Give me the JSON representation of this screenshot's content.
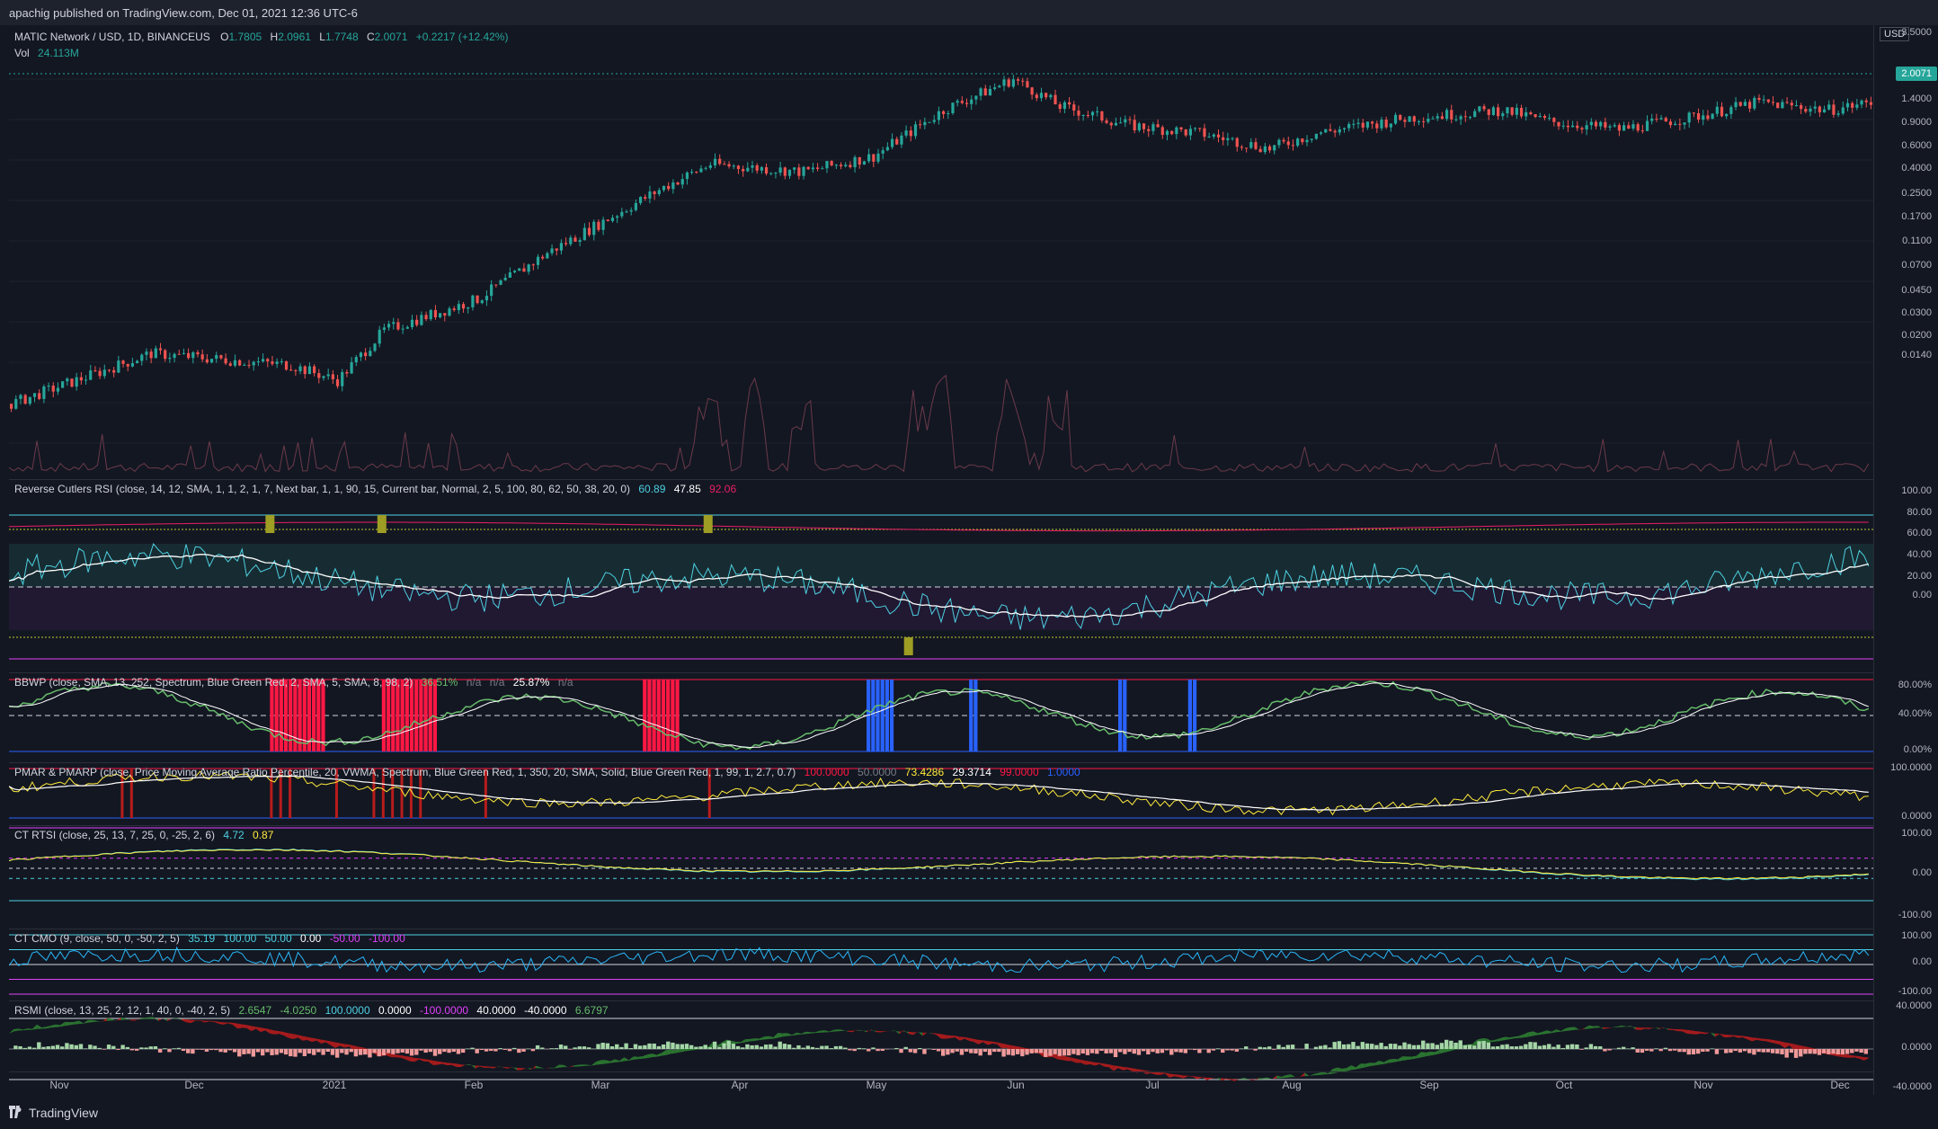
{
  "publisher": "apachig published on TradingView.com, Dec 01, 2021 12:36 UTC-6",
  "symbol": {
    "name": "MATIC Network / USD, 1D, BINANCEUS",
    "o_label": "O",
    "o": "1.7805",
    "h_label": "H",
    "h": "2.0961",
    "l_label": "L",
    "l": "1.7748",
    "c_label": "C",
    "c": "2.0071",
    "change": "+0.2217 (+12.42%)",
    "vol_label": "Vol",
    "vol": "24.113M"
  },
  "price_axis": {
    "currency": "USD",
    "last_price": "2.0071",
    "ticks": [
      "3.5000",
      "1.4000",
      "0.9000",
      "0.6000",
      "0.4000",
      "0.2500",
      "0.1700",
      "0.1100",
      "0.0700",
      "0.0450",
      "0.0300",
      "0.0200",
      "0.0140"
    ]
  },
  "indicators": [
    {
      "title": "Reverse Cutlers RSI (close, 14, 12, SMA, 1, 1, 2, 1, 7, Next bar, 1, 1, 90, 15, Current bar, Normal, 2, 5, 100, 80, 62, 50, 38, 20, 0)",
      "values": [
        "60.89",
        "47.85",
        "92.06"
      ],
      "value_colors": [
        "#4dd0e1",
        "#ffffff",
        "#e91e63"
      ],
      "axis": [
        "100.00",
        "80.00",
        "60.00",
        "40.00",
        "20.00",
        "0.00"
      ]
    },
    {
      "title": "BBWP (close, SMA, 13, 252, Spectrum, Blue Green Red, 2, SMA, 5, SMA, 8, 98, 2)",
      "values": [
        "36.51%",
        "n/a",
        "n/a",
        "25.87%",
        "n/a"
      ],
      "value_colors": [
        "#66bb6a",
        "#787b86",
        "#787b86",
        "#ffffff",
        "#787b86"
      ],
      "axis": [
        "80.00%",
        "40.00%",
        "0.00%"
      ]
    },
    {
      "title": "PMAR & PMARP (close, Price Moving Average Ratio Percentile, 20, VWMA, Spectrum, Blue Green Red, 1, 350, 20, SMA, Solid, Blue Green Red, 1, 99, 1, 2.7, 0.7)",
      "values": [
        "100.0000",
        "50.0000",
        "73.4286",
        "29.3714",
        "99.0000",
        "1.0000"
      ],
      "value_colors": [
        "#ff1744",
        "#787b86",
        "#ffeb3b",
        "#ffffff",
        "#ff1744",
        "#2962ff"
      ],
      "axis": [
        "100.0000",
        "0.0000"
      ]
    },
    {
      "title": "CT RTSI (close, 25, 13, 7, 25, 0, -25, 2, 6)",
      "values": [
        "4.72",
        "0.87"
      ],
      "value_colors": [
        "#4dd0e1",
        "#ffeb3b"
      ],
      "axis": [
        "100.00",
        "0.00",
        "-100.00"
      ]
    },
    {
      "title": "CT CMO (9, close, 50, 0, -50, 2, 5)",
      "values": [
        "35.19",
        "100.00",
        "50.00",
        "0.00",
        "-50.00",
        "-100.00"
      ],
      "value_colors": [
        "#4dd0e1",
        "#4dd0e1",
        "#4dd0e1",
        "#ffffff",
        "#e040fb",
        "#e040fb"
      ],
      "axis": [
        "100.00",
        "0.00",
        "-100.00"
      ]
    },
    {
      "title": "RSMI (close, 13, 25, 2, 12, 1, 40, 0, -40, 2, 5)",
      "values": [
        "2.6547",
        "-4.0250",
        "100.0000",
        "0.0000",
        "-100.0000",
        "40.0000",
        "-40.0000",
        "6.6797"
      ],
      "value_colors": [
        "#66bb6a",
        "#66bb6a",
        "#4dd0e1",
        "#ffffff",
        "#e040fb",
        "#ffffff",
        "#ffffff",
        "#66bb6a"
      ],
      "axis": [
        "40.0000",
        "0.0000",
        "-40.0000"
      ]
    }
  ],
  "time_axis": [
    "Nov",
    "Dec",
    "2021",
    "Feb",
    "Mar",
    "Apr",
    "May",
    "Jun",
    "Jul",
    "Aug",
    "Sep",
    "Oct",
    "Nov",
    "Dec"
  ],
  "footer": {
    "brand": "TradingView"
  },
  "colors": {
    "background": "#131722",
    "up": "#26a69a",
    "down": "#ef5350",
    "grid": "#1f2330"
  }
}
